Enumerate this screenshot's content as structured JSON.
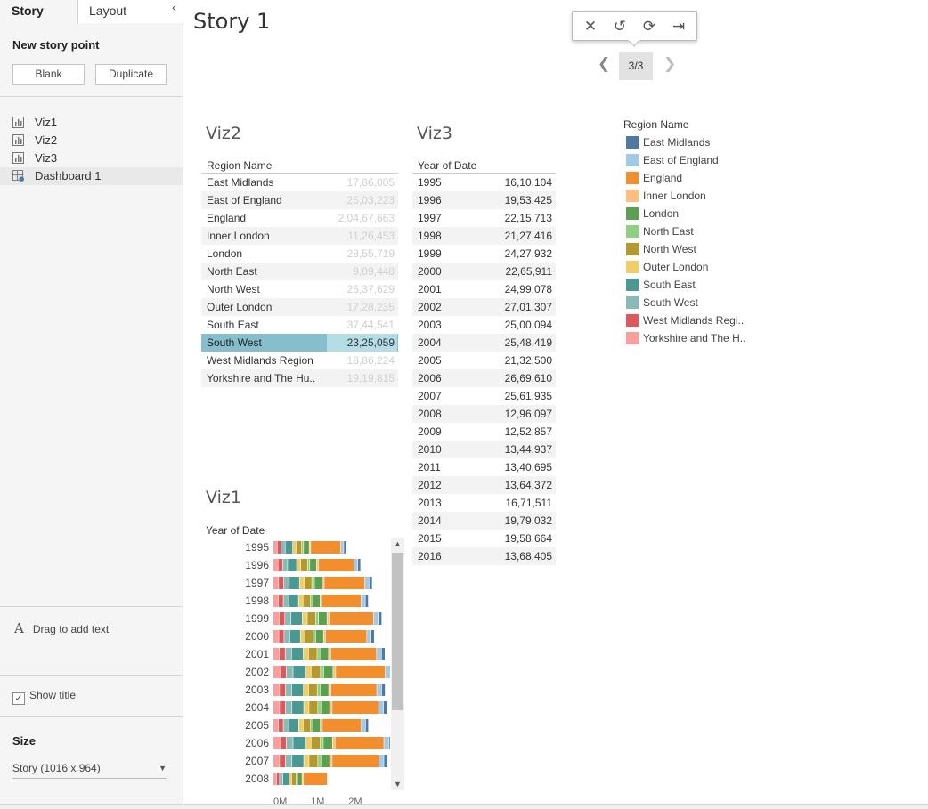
{
  "left_pane": {
    "tabs": [
      {
        "label": "Story"
      },
      {
        "label": "Layout"
      }
    ],
    "new_story_point": "New story point",
    "blank_button": "Blank",
    "duplicate_button": "Duplicate",
    "sheets": [
      {
        "label": "Viz1",
        "icon": "bar-chart-icon"
      },
      {
        "label": "Viz2",
        "icon": "bar-chart-icon"
      },
      {
        "label": "Viz3",
        "icon": "bar-chart-icon"
      },
      {
        "label": "Dashboard 1",
        "icon": "dashboard-icon"
      }
    ],
    "drag_text": "Drag to add text",
    "show_title": "Show title",
    "show_title_checked": true,
    "size_label": "Size",
    "size_value": "Story (1016 x 964)"
  },
  "story": {
    "title": "Story 1",
    "nav_counter": "3/3"
  },
  "viz2": {
    "title": "Viz2",
    "column_header": "Region Name",
    "selected_row": "South West",
    "rows": [
      {
        "label": "East Midlands",
        "value": "17,86,005"
      },
      {
        "label": "East of England",
        "value": "25,03,223"
      },
      {
        "label": "England",
        "value": "2,04,67,663"
      },
      {
        "label": "Inner London",
        "value": "11,26,453"
      },
      {
        "label": "London",
        "value": "28,55,719"
      },
      {
        "label": "North East",
        "value": "9,09,448"
      },
      {
        "label": "North West",
        "value": "25,37,629"
      },
      {
        "label": "Outer London",
        "value": "17,28,235"
      },
      {
        "label": "South East",
        "value": "37,44,541"
      },
      {
        "label": "South West",
        "value": "23,25,059"
      },
      {
        "label": "West Midlands Region",
        "value": "18,86,224"
      },
      {
        "label": "Yorkshire and The Hu..",
        "value": "19,19,815"
      }
    ]
  },
  "viz3": {
    "title": "Viz3",
    "column_header": "Year of Date",
    "rows": [
      {
        "label": "1995",
        "value": "16,10,104"
      },
      {
        "label": "1996",
        "value": "19,53,425"
      },
      {
        "label": "1997",
        "value": "22,15,713"
      },
      {
        "label": "1998",
        "value": "21,27,416"
      },
      {
        "label": "1999",
        "value": "24,27,932"
      },
      {
        "label": "2000",
        "value": "22,65,911"
      },
      {
        "label": "2001",
        "value": "24,99,078"
      },
      {
        "label": "2002",
        "value": "27,01,307"
      },
      {
        "label": "2003",
        "value": "25,00,094"
      },
      {
        "label": "2004",
        "value": "25,48,419"
      },
      {
        "label": "2005",
        "value": "21,32,500"
      },
      {
        "label": "2006",
        "value": "26,69,610"
      },
      {
        "label": "2007",
        "value": "25,61,935"
      },
      {
        "label": "2008",
        "value": "12,96,097"
      },
      {
        "label": "2009",
        "value": "12,52,857"
      },
      {
        "label": "2010",
        "value": "13,44,937"
      },
      {
        "label": "2011",
        "value": "13,40,695"
      },
      {
        "label": "2012",
        "value": "13,64,372"
      },
      {
        "label": "2013",
        "value": "16,71,511"
      },
      {
        "label": "2014",
        "value": "19,79,032"
      },
      {
        "label": "2015",
        "value": "19,58,664"
      },
      {
        "label": "2016",
        "value": "13,68,405"
      }
    ]
  },
  "legend": {
    "title": "Region Name",
    "items": [
      {
        "label": "East Midlands",
        "color": "#4e79a7"
      },
      {
        "label": "East of England",
        "color": "#a0cbe8"
      },
      {
        "label": "England",
        "color": "#f28e2b"
      },
      {
        "label": "Inner London",
        "color": "#ffbe7d"
      },
      {
        "label": "London",
        "color": "#59a14f"
      },
      {
        "label": "North East",
        "color": "#8cd17d"
      },
      {
        "label": "North West",
        "color": "#b6992d"
      },
      {
        "label": "Outer London",
        "color": "#f1ce63"
      },
      {
        "label": "South East",
        "color": "#499894"
      },
      {
        "label": "South West",
        "color": "#86bcb6"
      },
      {
        "label": "West Midlands Regi..",
        "color": "#e15759"
      },
      {
        "label": "Yorkshire and The H..",
        "color": "#ff9d9a"
      }
    ]
  },
  "viz1": {
    "title": "Viz1",
    "axis_header": "Year of Date",
    "x_tick_labels": [
      "0M",
      "1M",
      "2M"
    ],
    "years": [
      "1995",
      "1996",
      "1997",
      "1998",
      "1999",
      "2000",
      "2001",
      "2002",
      "2003",
      "2004",
      "2005",
      "2006",
      "2007",
      "2008"
    ]
  },
  "chart_data": {
    "type": "bar",
    "stacked": true,
    "orientation": "horizontal",
    "categories": [
      "1995",
      "1996",
      "1997",
      "1998",
      "1999",
      "2000",
      "2001",
      "2002",
      "2003",
      "2004",
      "2005",
      "2006",
      "2007",
      "2008"
    ],
    "xlim": [
      0,
      2800000
    ],
    "x_ticks": [
      "0M",
      "1M",
      "2M"
    ],
    "series": [
      {
        "name": "Yorkshire and The H..",
        "color": "#ff9d9a",
        "values": [
          110000,
          130000,
          145000,
          140000,
          160000,
          150000,
          165000,
          180000,
          170000,
          170000,
          140000,
          180000,
          170000,
          90000
        ]
      },
      {
        "name": "West Midlands Regi..",
        "color": "#e15759",
        "values": [
          100000,
          120000,
          135000,
          130000,
          150000,
          140000,
          155000,
          165000,
          155000,
          155000,
          130000,
          165000,
          155000,
          80000
        ]
      },
      {
        "name": "South West",
        "color": "#86bcb6",
        "values": [
          110000,
          135000,
          150000,
          145000,
          165000,
          155000,
          170000,
          185000,
          170000,
          175000,
          145000,
          185000,
          175000,
          90000
        ]
      },
      {
        "name": "South East",
        "color": "#499894",
        "values": [
          200000,
          240000,
          270000,
          260000,
          300000,
          280000,
          310000,
          330000,
          310000,
          315000,
          265000,
          330000,
          315000,
          160000
        ]
      },
      {
        "name": "Outer London",
        "color": "#f1ce63",
        "values": [
          90000,
          110000,
          125000,
          120000,
          135000,
          125000,
          140000,
          150000,
          140000,
          140000,
          120000,
          150000,
          140000,
          70000
        ]
      },
      {
        "name": "North West",
        "color": "#b6992d",
        "values": [
          150000,
          180000,
          205000,
          195000,
          225000,
          210000,
          230000,
          250000,
          230000,
          235000,
          195000,
          245000,
          235000,
          120000
        ]
      },
      {
        "name": "North East",
        "color": "#8cd17d",
        "values": [
          50000,
          60000,
          70000,
          65000,
          75000,
          70000,
          75000,
          85000,
          75000,
          80000,
          65000,
          80000,
          80000,
          40000
        ]
      },
      {
        "name": "London",
        "color": "#59a14f",
        "values": [
          150000,
          180000,
          205000,
          195000,
          225000,
          210000,
          230000,
          250000,
          230000,
          235000,
          195000,
          245000,
          235000,
          120000
        ]
      },
      {
        "name": "Inner London",
        "color": "#ffbe7d",
        "values": [
          40000,
          50000,
          55000,
          55000,
          60000,
          55000,
          60000,
          70000,
          60000,
          65000,
          55000,
          70000,
          65000,
          30000
        ]
      },
      {
        "name": "England",
        "color": "#f28e2b",
        "values": [
          800000,
          950000,
          1080000,
          1040000,
          1180000,
          1100000,
          1220000,
          1320000,
          1220000,
          1240000,
          1040000,
          1300000,
          1250000,
          640000
        ]
      },
      {
        "name": "East of England",
        "color": "#a0cbe8",
        "values": [
          80000,
          100000,
          115000,
          110000,
          125000,
          115000,
          130000,
          140000,
          130000,
          130000,
          110000,
          140000,
          130000,
          0
        ]
      },
      {
        "name": "East Midlands",
        "color": "#4e79a7",
        "values": [
          60000,
          75000,
          85000,
          80000,
          95000,
          85000,
          95000,
          105000,
          95000,
          100000,
          80000,
          100000,
          100000,
          0
        ]
      }
    ]
  }
}
